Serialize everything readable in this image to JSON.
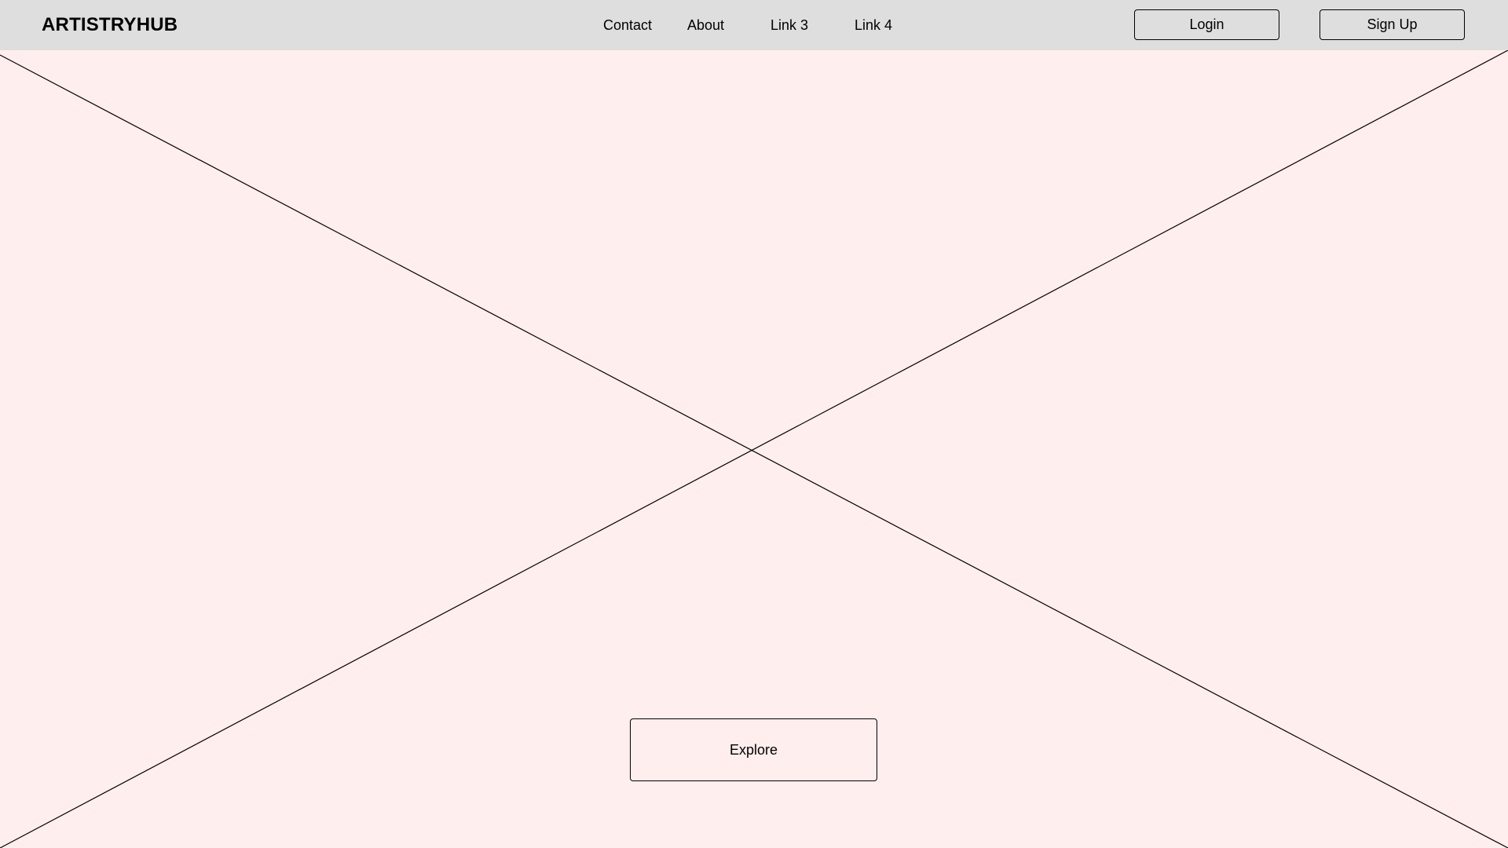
{
  "header": {
    "brand": "ARTISTRYHUB",
    "links": [
      "Contact",
      "About",
      "Link 3",
      "Link 4"
    ],
    "login_label": "Login",
    "signup_label": "Sign Up"
  },
  "hero": {
    "placeholder_icon": "image-placeholder-cross-icon",
    "explore_label": "Explore"
  },
  "colors": {
    "navbar_bg": "#dedede",
    "page_bg": "#ffeeed",
    "stroke": "#000000"
  }
}
